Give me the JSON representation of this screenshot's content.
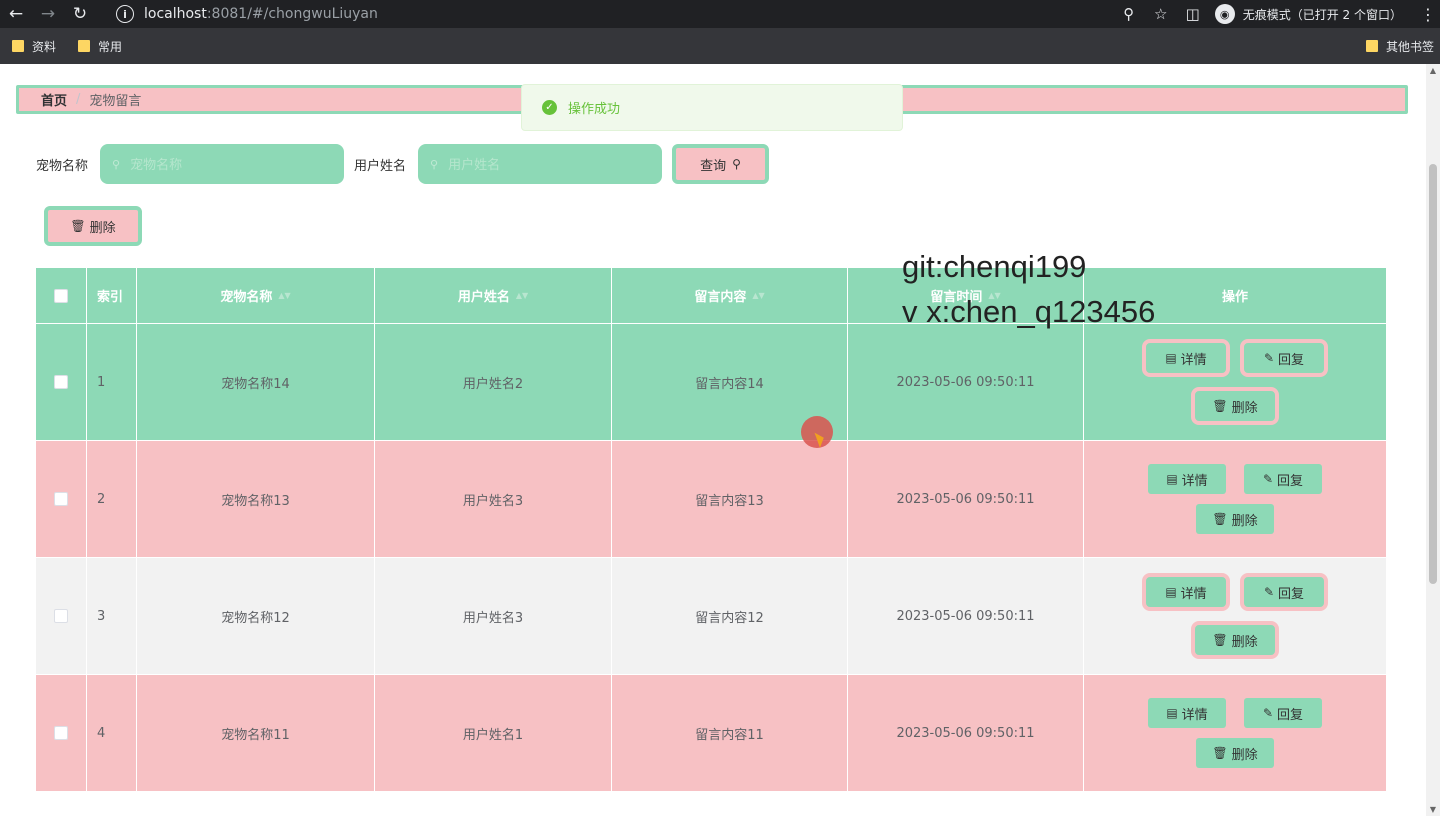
{
  "browser": {
    "url_host": "localhost",
    "url_path": ":8081/#/chongwuLiuyan",
    "incognito_label": "无痕模式（已打开 2 个窗口）",
    "bookmarks": [
      "资料",
      "常用"
    ],
    "other_bookmarks": "其他书签"
  },
  "breadcrumb": {
    "home": "首页",
    "sep": "/",
    "current": "宠物留言"
  },
  "toast": {
    "text": "操作成功"
  },
  "search": {
    "pet_label": "宠物名称",
    "pet_placeholder": "宠物名称",
    "user_label": "用户姓名",
    "user_placeholder": "用户姓名",
    "query_label": "查询"
  },
  "toolbar": {
    "delete_label": "删除"
  },
  "watermark": {
    "line1": "git:chenqi199",
    "line2": "v x:chen_q123456"
  },
  "table": {
    "headers": {
      "index": "索引",
      "pet_name": "宠物名称",
      "user_name": "用户姓名",
      "content": "留言内容",
      "time": "留言时间",
      "ops": "操作"
    },
    "rows": [
      {
        "index": "1",
        "pet_name": "宠物名称14",
        "user_name": "用户姓名2",
        "content": "留言内容14",
        "time": "2023-05-06 09:50:11"
      },
      {
        "index": "2",
        "pet_name": "宠物名称13",
        "user_name": "用户姓名3",
        "content": "留言内容13",
        "time": "2023-05-06 09:50:11"
      },
      {
        "index": "3",
        "pet_name": "宠物名称12",
        "user_name": "用户姓名3",
        "content": "留言内容12",
        "time": "2023-05-06 09:50:11"
      },
      {
        "index": "4",
        "pet_name": "宠物名称11",
        "user_name": "用户姓名1",
        "content": "留言内容11",
        "time": "2023-05-06 09:50:11"
      }
    ],
    "op_labels": {
      "detail": "详情",
      "reply": "回复",
      "delete": "删除"
    }
  },
  "colors": {
    "green": "#8dd9b6",
    "pink": "#f7c1c4",
    "success": "#67c23a"
  }
}
